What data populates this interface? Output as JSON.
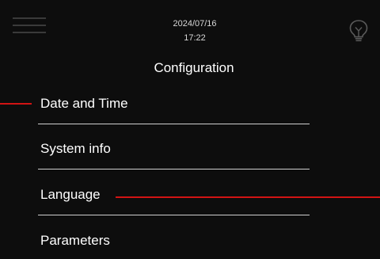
{
  "header": {
    "date": "2024/07/16",
    "time": "17:22",
    "menu_icon": "hamburger-menu-icon",
    "bulb_icon": "lightbulb-icon"
  },
  "title": "Configuration",
  "menu": {
    "items": [
      {
        "label": "Date and Time"
      },
      {
        "label": "System info"
      },
      {
        "label": "Language"
      },
      {
        "label": "Parameters"
      }
    ]
  },
  "colors": {
    "background": "#0d0d0d",
    "text": "#ffffff",
    "divider": "#cfcfcf",
    "callout": "#d11414",
    "icon_dim": "#3a3a3a"
  }
}
